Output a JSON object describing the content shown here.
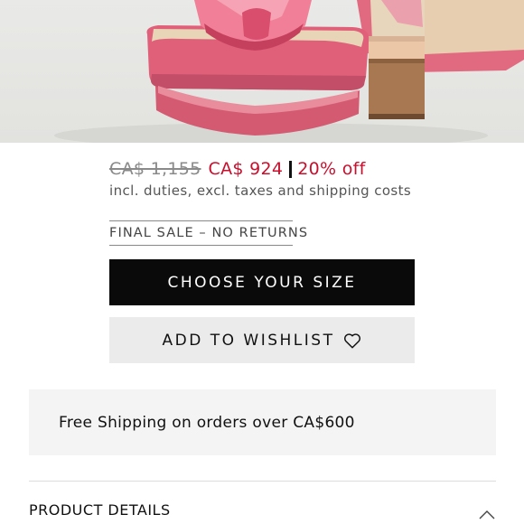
{
  "product_image": {
    "alt": ""
  },
  "price": {
    "original": "CA$ 1,155",
    "sale": "CA$ 924",
    "discount": "20% off",
    "tax_note": "incl. duties, excl. taxes and shipping costs"
  },
  "final_sale_label": "FINAL SALE – NO RETURNS",
  "buttons": {
    "choose_size": "CHOOSE YOUR SIZE",
    "add_to_wishlist": "ADD TO WISHLIST"
  },
  "shipping_banner": "Free Shipping on orders over CA$600",
  "accordion": {
    "product_details": "PRODUCT DETAILS",
    "icon": "chevron-up-icon"
  },
  "colors": {
    "sale_red": "#c8102e",
    "primary_button": "#0a0a0a",
    "secondary_button": "#ebebeb",
    "shoe_pink": "#e76a82"
  }
}
